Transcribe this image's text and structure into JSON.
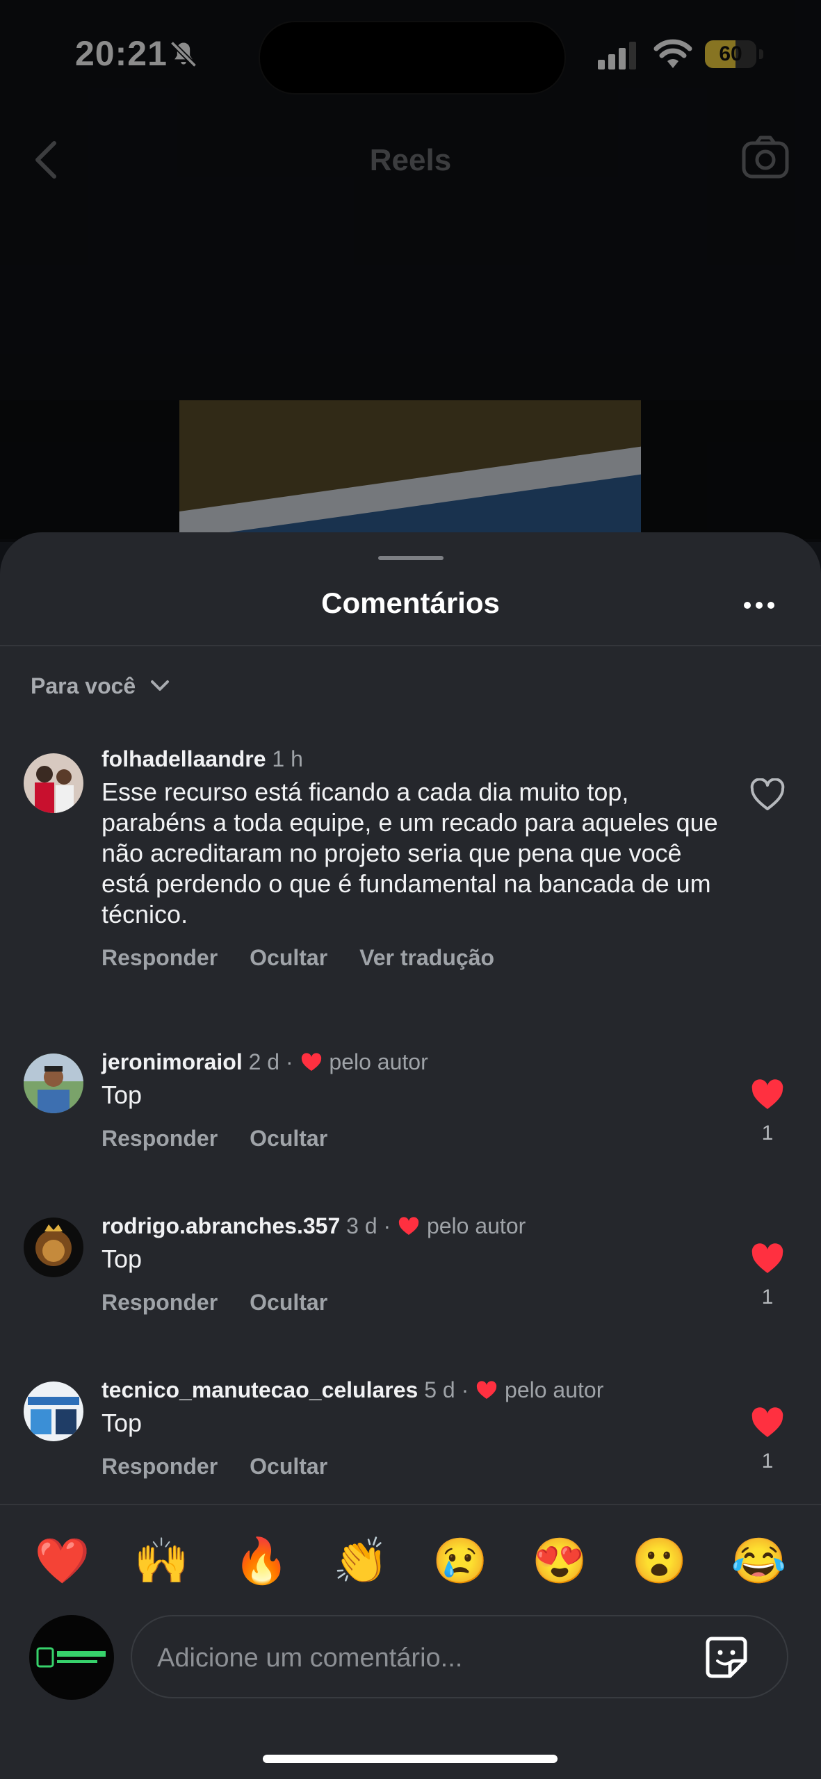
{
  "status_bar": {
    "time": "20:21",
    "battery": "60",
    "battery_level": 0.6
  },
  "nav": {
    "title": "Reels"
  },
  "sheet": {
    "title": "Comentários",
    "filter_label": "Para você"
  },
  "comments": [
    {
      "username": "folhadellaandre",
      "age": "1 h",
      "text": "Esse recurso está ficando a cada dia muito top, parabéns a toda equipe, e um recado para aqueles que não acreditaram no projeto seria que pena que você está perdendo o que é fundamental na bancada de um técnico.",
      "actions": [
        "Responder",
        "Ocultar",
        "Ver tradução"
      ],
      "liked": false
    },
    {
      "username": "jeronimoraiol",
      "age": "2 d ·",
      "author_like": "pelo autor",
      "text": "Top",
      "actions": [
        "Responder",
        "Ocultar"
      ],
      "liked": true,
      "likes": "1"
    },
    {
      "username": "rodrigo.abranches.357",
      "age": "3 d ·",
      "author_like": "pelo autor",
      "text": "Top",
      "actions": [
        "Responder",
        "Ocultar"
      ],
      "liked": true,
      "likes": "1"
    },
    {
      "username": "tecnico_manutecao_celulares",
      "age": "5 d ·",
      "author_like": "pelo autor",
      "text": "Top",
      "actions": [
        "Responder",
        "Ocultar"
      ],
      "liked": true,
      "likes": "1"
    }
  ],
  "reactions": [
    "❤️",
    "🙌",
    "🔥",
    "👏",
    "😢",
    "😍",
    "😮",
    "😂"
  ],
  "composer": {
    "placeholder": "Adicione um comentário..."
  },
  "colors": {
    "like_red": "#ff3040",
    "sheet_bg": "#25272c",
    "muted_text": "#9fa3a8"
  }
}
